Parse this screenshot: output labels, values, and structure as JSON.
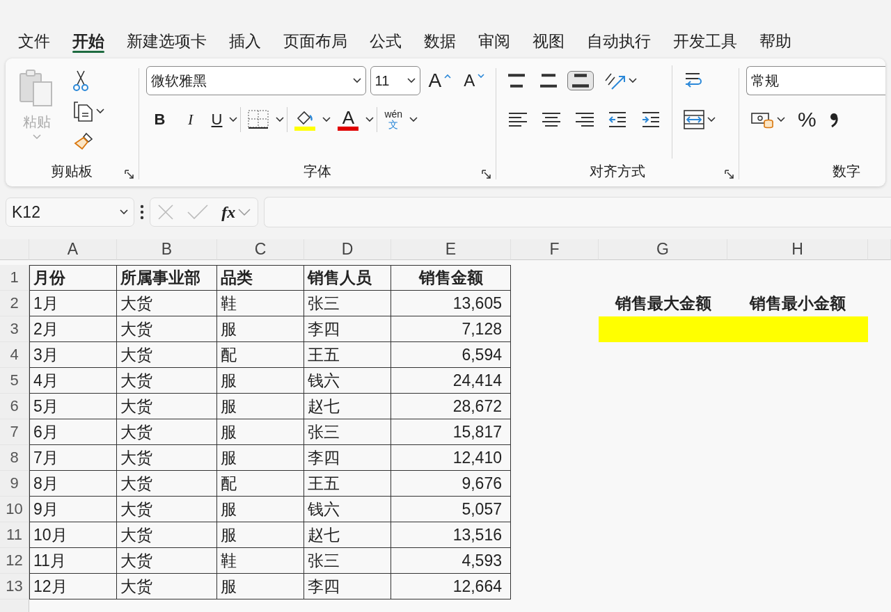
{
  "tabs": [
    {
      "label": "文件",
      "selected": false
    },
    {
      "label": "开始",
      "selected": true
    },
    {
      "label": "新建选项卡",
      "selected": false
    },
    {
      "label": "插入",
      "selected": false
    },
    {
      "label": "页面布局",
      "selected": false
    },
    {
      "label": "公式",
      "selected": false
    },
    {
      "label": "数据",
      "selected": false
    },
    {
      "label": "审阅",
      "selected": false
    },
    {
      "label": "视图",
      "selected": false
    },
    {
      "label": "自动执行",
      "selected": false
    },
    {
      "label": "开发工具",
      "selected": false
    },
    {
      "label": "帮助",
      "selected": false
    }
  ],
  "ribbon": {
    "clipboard": {
      "label": "剪贴板",
      "paste": {
        "label": "粘贴",
        "disabled": true
      }
    },
    "font": {
      "label": "字体",
      "font_name": "微软雅黑",
      "font_size": "11",
      "grow": "A",
      "shrink": "A",
      "bold": "B",
      "italic": "I",
      "underline": "U",
      "font_color": "A",
      "phonetic_top": "wén",
      "phonetic_bottom": "文"
    },
    "alignment": {
      "label": "对齐方式",
      "vertical": [
        {
          "selected": false
        },
        {
          "selected": false
        },
        {
          "selected": true
        }
      ]
    },
    "number": {
      "label": "数字",
      "format": "常规",
      "percent": "%"
    }
  },
  "formula_bar": {
    "name_box": "K12",
    "function_label": "fx"
  },
  "sheet": {
    "columns": [
      "A",
      "B",
      "C",
      "D",
      "E",
      "F",
      "G",
      "H"
    ],
    "rows": [
      {
        "number": "1",
        "kind": "header",
        "cells": [
          "月份",
          "所属事业部",
          "品类",
          "销售人员",
          "销售金额"
        ]
      },
      {
        "number": "2",
        "kind": "data",
        "cells": [
          "1月",
          "大货",
          "鞋",
          "张三",
          "13,605"
        ]
      },
      {
        "number": "3",
        "kind": "data",
        "cells": [
          "2月",
          "大货",
          "服",
          "李四",
          "7,128"
        ]
      },
      {
        "number": "4",
        "kind": "data",
        "cells": [
          "3月",
          "大货",
          "配",
          "王五",
          "6,594"
        ]
      },
      {
        "number": "5",
        "kind": "data",
        "cells": [
          "4月",
          "大货",
          "服",
          "钱六",
          "24,414"
        ]
      },
      {
        "number": "6",
        "kind": "data",
        "cells": [
          "5月",
          "大货",
          "服",
          "赵七",
          "28,672"
        ]
      },
      {
        "number": "7",
        "kind": "data",
        "cells": [
          "6月",
          "大货",
          "服",
          "张三",
          "15,817"
        ]
      },
      {
        "number": "8",
        "kind": "data",
        "cells": [
          "7月",
          "大货",
          "服",
          "李四",
          "12,410"
        ]
      },
      {
        "number": "9",
        "kind": "data",
        "cells": [
          "8月",
          "大货",
          "配",
          "王五",
          "9,676"
        ]
      },
      {
        "number": "10",
        "kind": "data",
        "cells": [
          "9月",
          "大货",
          "服",
          "钱六",
          "5,057"
        ]
      },
      {
        "number": "11",
        "kind": "data",
        "cells": [
          "10月",
          "大货",
          "服",
          "赵七",
          "13,516"
        ]
      },
      {
        "number": "12",
        "kind": "data",
        "cells": [
          "11月",
          "大货",
          "鞋",
          "张三",
          "4,593"
        ]
      },
      {
        "number": "13",
        "kind": "data",
        "cells": [
          "12月",
          "大货",
          "服",
          "李四",
          "12,664"
        ]
      }
    ],
    "summary": {
      "labels": [
        "销售最大金额",
        "销售最小金额"
      ],
      "fills": [
        {
          "color": "#ffff00"
        },
        {
          "color": "#ffff00"
        }
      ]
    }
  }
}
